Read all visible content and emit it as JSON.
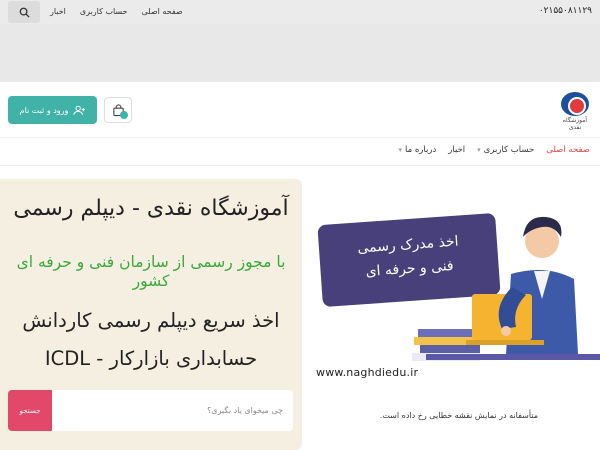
{
  "topbar": {
    "phone": "۰۲۱۵۵۰۸۱۱۲۹",
    "links": [
      "صفحه اصلی",
      "حساب کاربری",
      "اخبار"
    ]
  },
  "header": {
    "logo_text": "آموزشگاه نقدی",
    "login_label": "ورود و ثبت نام"
  },
  "nav": {
    "items": [
      "صفحه اصلی",
      "حساب کاربری",
      "اخبار",
      "درباره ما"
    ]
  },
  "hero": {
    "title": "آموزشگاه نقدی - دیپلم رسمی",
    "subtitle": "با مجوز رسمی از سازمان فنی و حرفه ای کشور",
    "line1": "اخذ سریع دیپلم رسمی کاردانش",
    "line2": "ICDL - حسابداری بازارکار",
    "search_placeholder": "چی میخوای یاد بگیری؟",
    "search_button": "جستجو",
    "bubble_line1": "اخذ مدرک رسمی",
    "bubble_line2": "فنی و حرفه ای",
    "url": "www.naghdiedu.ir",
    "map_error": "متأسفانه در نمایش نقشه خطایی رخ داده است."
  },
  "colors": {
    "accent": "#41b2a8",
    "active_nav": "#e24343",
    "subtitle_green": "#3aa83a",
    "search_button": "#e2486a",
    "bubble": "#47407a"
  }
}
